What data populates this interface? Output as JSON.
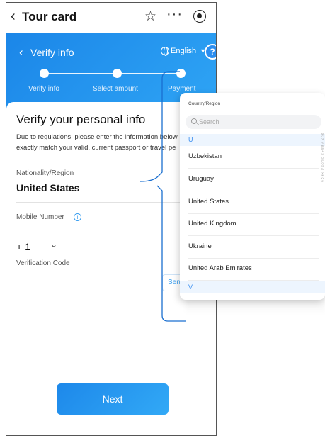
{
  "titlebar": {
    "title": "Tour card",
    "back_glyph": "‹",
    "star_glyph": "☆",
    "more_glyph": "···"
  },
  "header": {
    "back_glyph": "‹",
    "title": "Verify info",
    "language": "English",
    "language_chevron": "▼",
    "steps": [
      "Verify info",
      "Select amount",
      "Payment"
    ],
    "help_glyph": "?"
  },
  "form": {
    "title": "Verify your personal info",
    "description_line1": "Due to regulations, please enter the information below",
    "description_line2": "exactly match your valid, current passport or travel pe",
    "nationality_label": "Nationality/Region",
    "nationality_value": "United States",
    "mobile_label": "Mobile Number",
    "info_glyph": "i",
    "country_code": "+ 1",
    "code_chevron": "⌄",
    "verification_label": "Verification Code",
    "send_label": "Send",
    "next_label": "Next"
  },
  "popup": {
    "title": "Country/Region",
    "search_placeholder": "Search",
    "section_u": "U",
    "countries": [
      "Uzbekistan",
      "Uruguay",
      "United States",
      "United Kingdom",
      "Ukraine",
      "United Arab Emirates"
    ],
    "section_v": "V",
    "alpha_index": "ABCDEFGHIJKLMNOPQRSTUVWXYZ"
  },
  "colors": {
    "primary_blue": "#1b86e8",
    "accent_blue": "#3a9ff0",
    "section_bg": "#edf5fe"
  }
}
